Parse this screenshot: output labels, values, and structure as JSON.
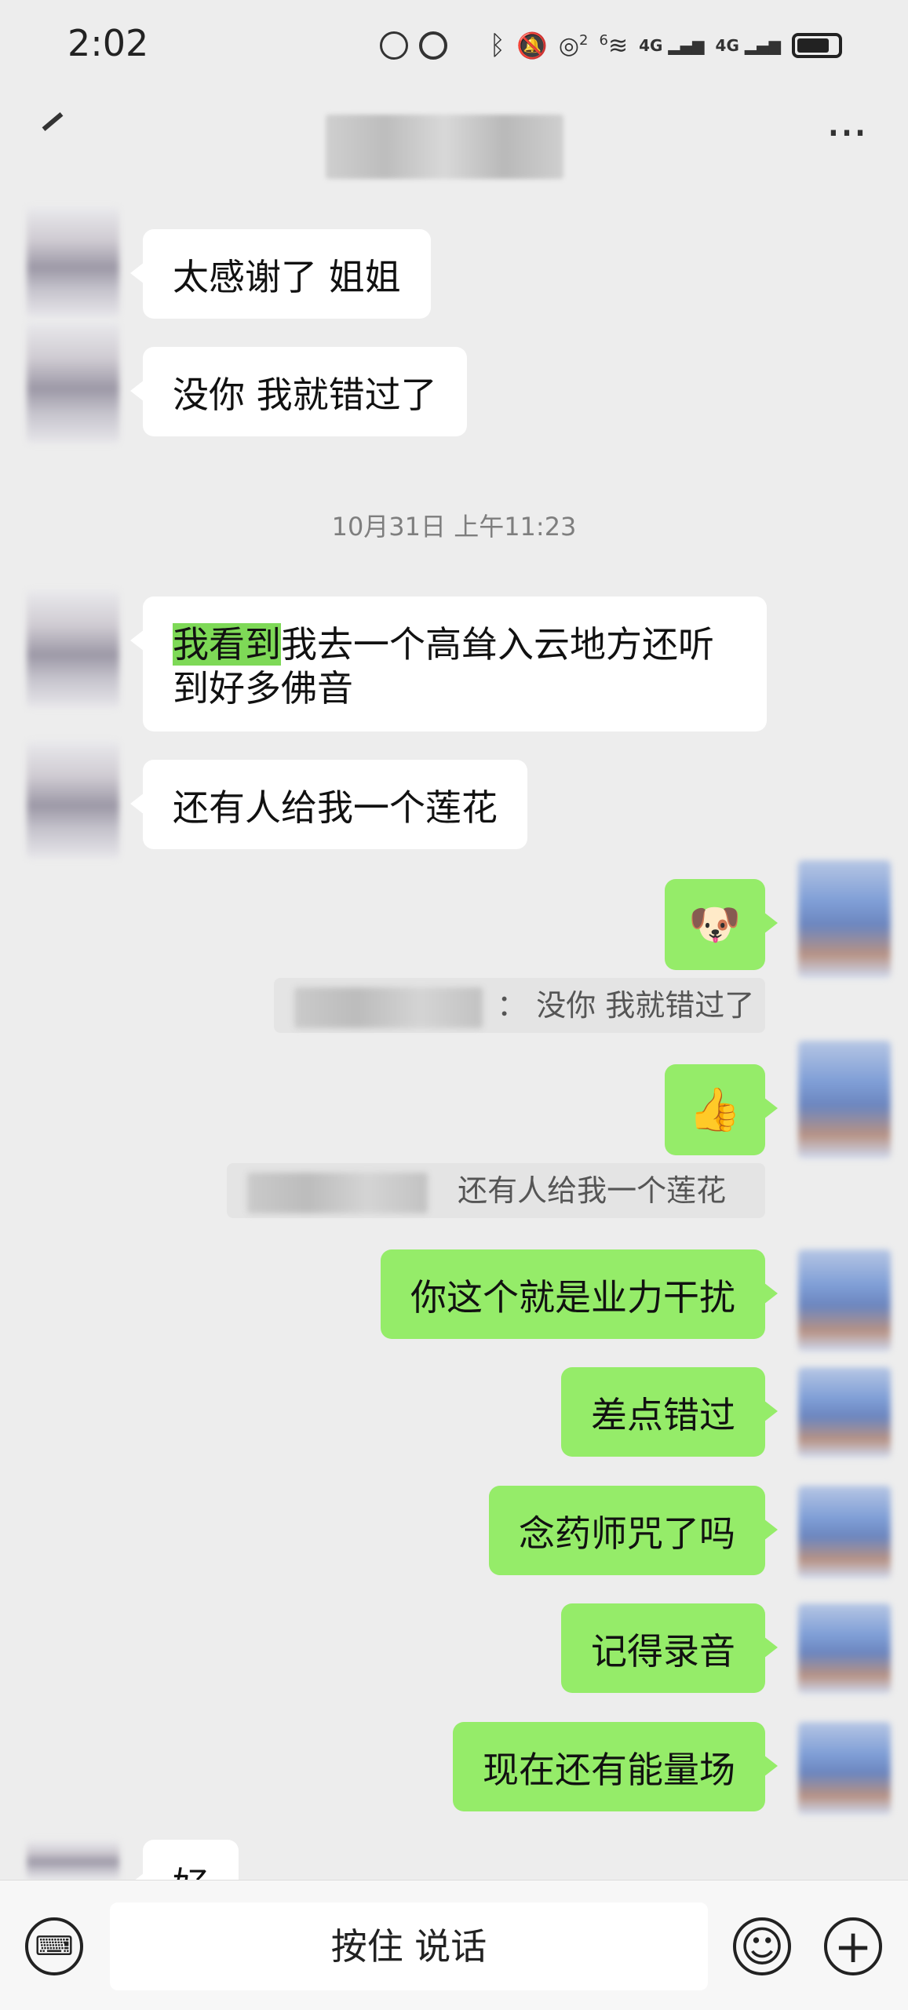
{
  "status_bar": {
    "time": "2:02",
    "icons": [
      "data-saver-icon",
      "alarm-icon",
      "bluetooth-icon",
      "mute-icon",
      "hotspot-icon",
      "wifi-icon",
      "signal-4g-icon",
      "signal-4g-icon",
      "battery-icon"
    ],
    "wifi_label": "6",
    "hotspot_label": "2",
    "network_1": "4G",
    "network_2": "4G"
  },
  "header": {
    "back_icon": "back-arrow-icon",
    "more_icon": "more-icon",
    "more_label": "···"
  },
  "messages": [
    {
      "side": "left",
      "text": "太感谢了  姐姐"
    },
    {
      "side": "left",
      "text": "没你 我就错过了"
    },
    {
      "type": "timestamp",
      "text": "10月31日 上午11:23"
    },
    {
      "side": "left",
      "highlight": "我看到",
      "text_line1_rest": "我去一个高耸入云地方还听",
      "text_line2": "到好多佛音"
    },
    {
      "side": "left",
      "text": "还有人给我一个莲花"
    },
    {
      "side": "right",
      "type": "emoji",
      "emoji": "🐶"
    },
    {
      "type": "quote",
      "sep": "：",
      "text": "没你 我就错过了"
    },
    {
      "side": "right",
      "type": "emoji",
      "emoji": "👍"
    },
    {
      "type": "quote",
      "text": "还有人给我一个莲花"
    },
    {
      "side": "right",
      "text": "你这个就是业力干扰"
    },
    {
      "side": "right",
      "text": "差点错过"
    },
    {
      "side": "right",
      "text": "念药师咒了吗"
    },
    {
      "side": "right",
      "text": "记得录音"
    },
    {
      "side": "right",
      "text": "现在还有能量场"
    },
    {
      "side": "left",
      "text": "好"
    }
  ],
  "input_bar": {
    "keyboard_icon": "keyboard-icon",
    "keyboard_glyph": "⌨",
    "voice_label": "按住 说话",
    "emoji_icon": "emoji-icon",
    "emoji_glyph": "☺",
    "plus_icon": "plus-icon",
    "plus_glyph": "+"
  }
}
